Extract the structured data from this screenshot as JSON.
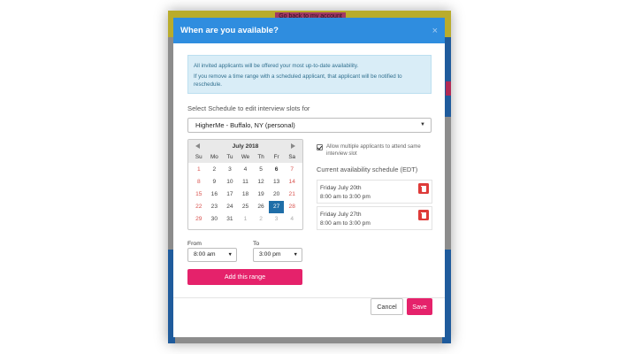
{
  "background": {
    "pill_text": "Go back to my account"
  },
  "modal": {
    "title": "When are you available?",
    "close_glyph": "×",
    "info": {
      "line1": "All invited applicants will be offered your most up-to-date availability.",
      "line2": "If you remove a time range with a scheduled applicant, that applicant will be notified to reschedule."
    },
    "schedule_label": "Select Schedule to edit interview slots for",
    "schedule_value": "HigherMe - Buffalo, NY (personal)",
    "calendar": {
      "month": "July 2018",
      "dow": [
        "Su",
        "Mo",
        "Tu",
        "We",
        "Th",
        "Fr",
        "Sa"
      ],
      "days": [
        {
          "d": "1",
          "c": "we"
        },
        {
          "d": "2",
          "c": ""
        },
        {
          "d": "3",
          "c": ""
        },
        {
          "d": "4",
          "c": ""
        },
        {
          "d": "5",
          "c": ""
        },
        {
          "d": "6",
          "c": "bold"
        },
        {
          "d": "7",
          "c": "we"
        },
        {
          "d": "8",
          "c": "we"
        },
        {
          "d": "9",
          "c": ""
        },
        {
          "d": "10",
          "c": ""
        },
        {
          "d": "11",
          "c": ""
        },
        {
          "d": "12",
          "c": ""
        },
        {
          "d": "13",
          "c": ""
        },
        {
          "d": "14",
          "c": "we"
        },
        {
          "d": "15",
          "c": "we"
        },
        {
          "d": "16",
          "c": ""
        },
        {
          "d": "17",
          "c": ""
        },
        {
          "d": "18",
          "c": ""
        },
        {
          "d": "19",
          "c": ""
        },
        {
          "d": "20",
          "c": ""
        },
        {
          "d": "21",
          "c": "we"
        },
        {
          "d": "22",
          "c": "we"
        },
        {
          "d": "23",
          "c": ""
        },
        {
          "d": "24",
          "c": ""
        },
        {
          "d": "25",
          "c": ""
        },
        {
          "d": "26",
          "c": ""
        },
        {
          "d": "27",
          "c": "sel"
        },
        {
          "d": "28",
          "c": "we"
        },
        {
          "d": "29",
          "c": "we"
        },
        {
          "d": "30",
          "c": ""
        },
        {
          "d": "31",
          "c": ""
        },
        {
          "d": "1",
          "c": "muted"
        },
        {
          "d": "2",
          "c": "muted"
        },
        {
          "d": "3",
          "c": "muted"
        },
        {
          "d": "4",
          "c": "muted"
        }
      ],
      "selected_day": "27"
    },
    "from_label": "From",
    "to_label": "To",
    "from_value": "8:00 am",
    "to_value": "3:00 pm",
    "add_range_label": "Add this range",
    "allow_multiple_label": "Allow multiple applicants to attend same interview slot",
    "allow_multiple_checked": true,
    "current_schedule_label": "Current availability schedule (EDT)",
    "slots": [
      {
        "date": "Friday July 20th",
        "range": "8:00 am to 3:00 pm"
      },
      {
        "date": "Friday July 27th",
        "range": "8:00 am to 3:00 pm"
      }
    ],
    "cancel_label": "Cancel",
    "save_label": "Save"
  },
  "colors": {
    "header_blue": "#2f8ddf",
    "accent_pink": "#e5226b",
    "selected_day": "#1f6ea8",
    "weekend_red": "#d9534f",
    "delete_red": "#de3b39"
  }
}
